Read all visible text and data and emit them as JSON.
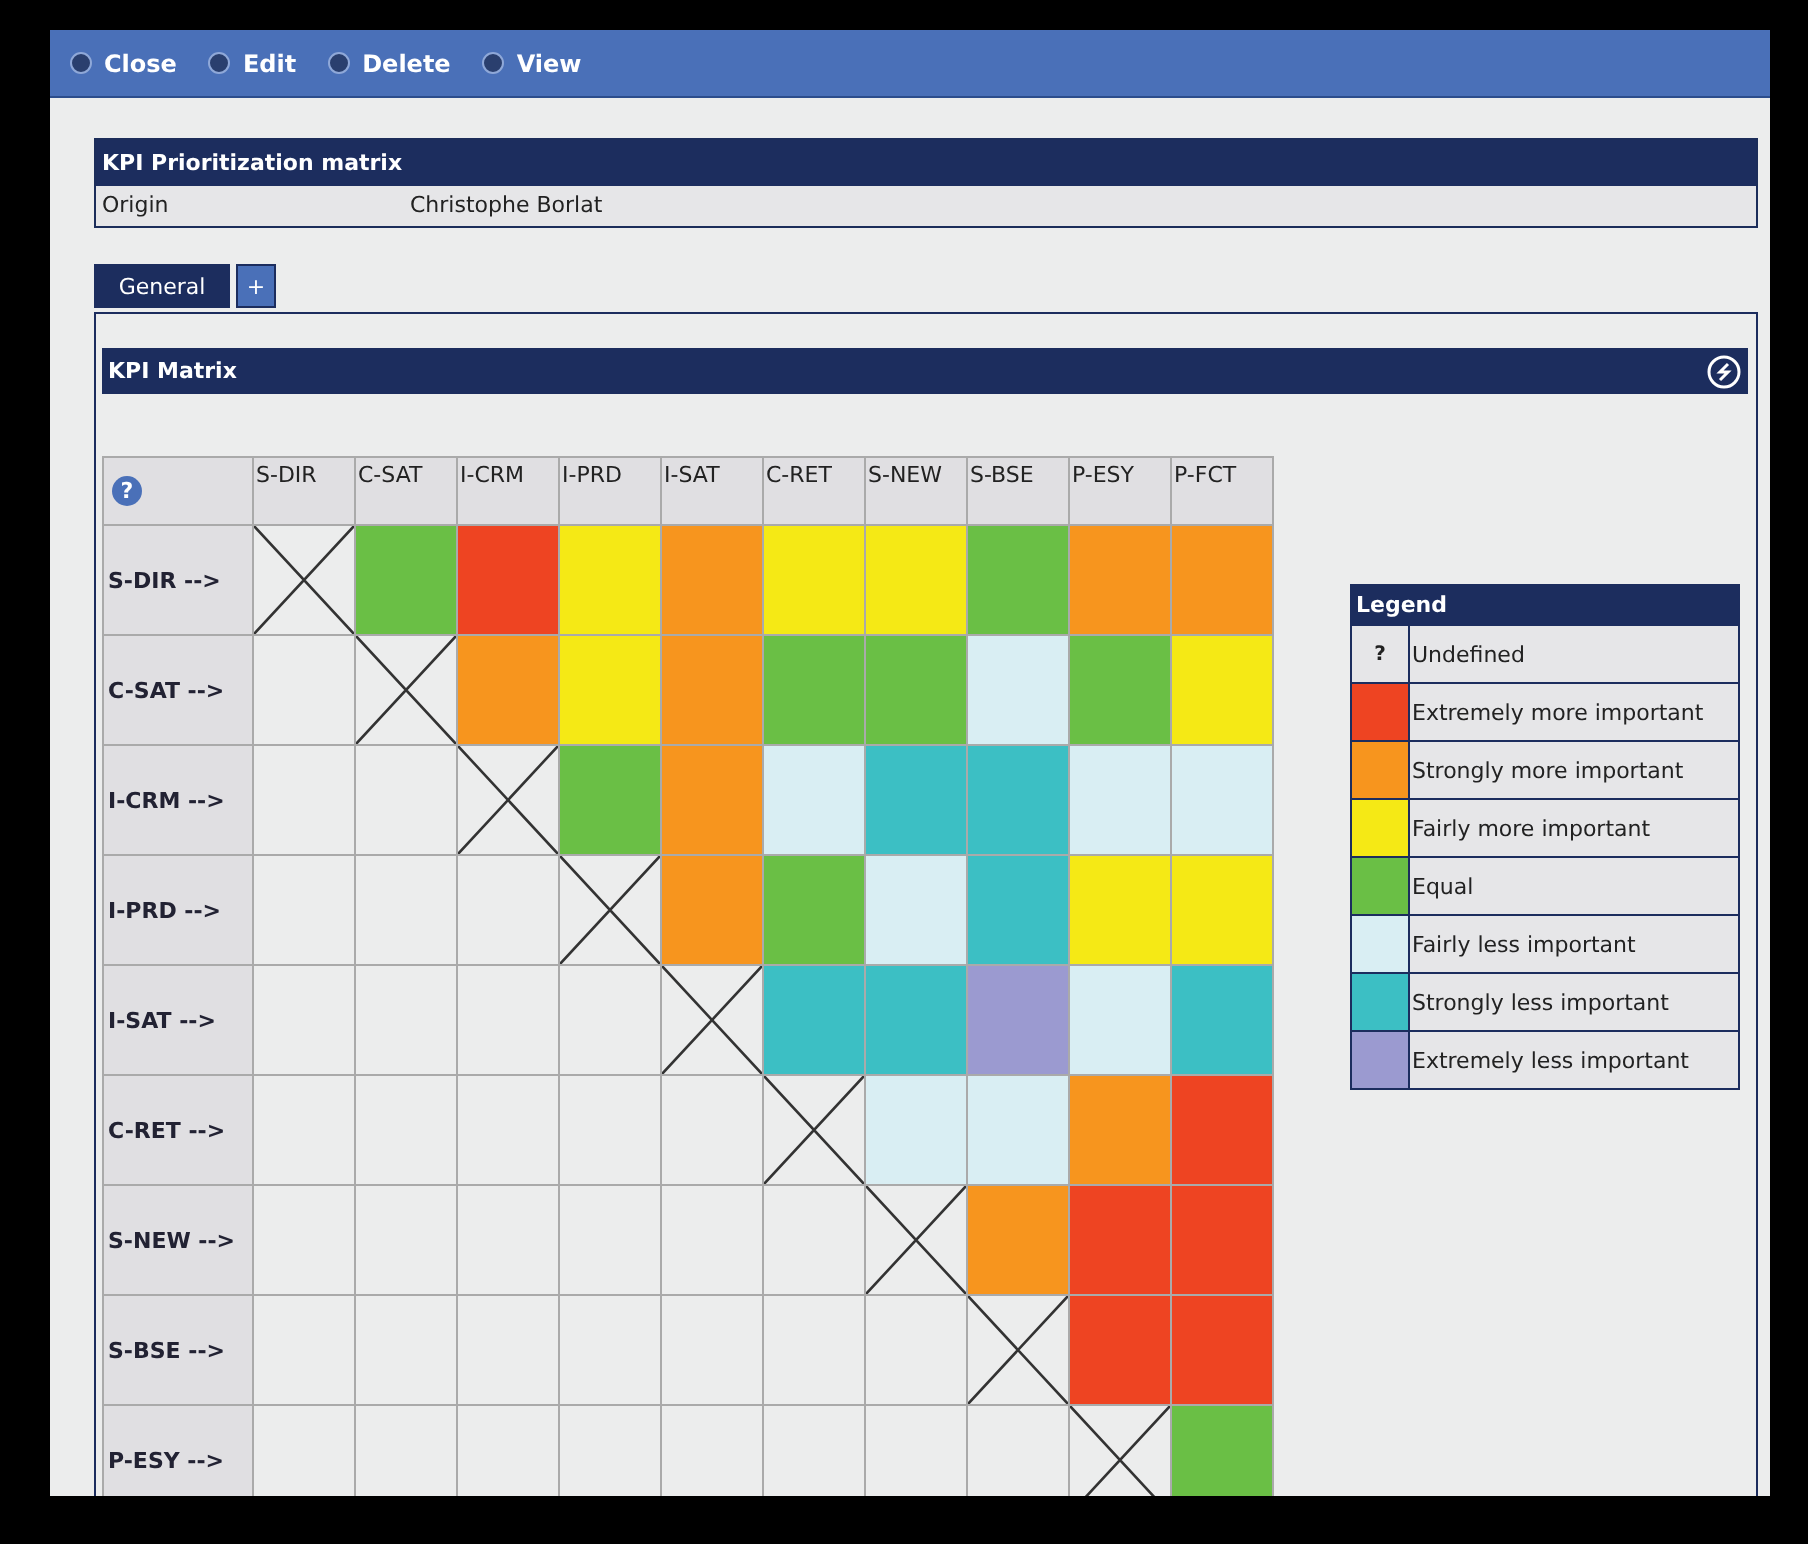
{
  "toolbar": [
    {
      "label": "Close"
    },
    {
      "label": "Edit"
    },
    {
      "label": "Delete"
    },
    {
      "label": "View"
    }
  ],
  "record": {
    "title": "KPI Prioritization matrix",
    "field_label": "Origin",
    "field_value": "Christophe Borlat"
  },
  "tabs": [
    {
      "label": "General",
      "selected": true
    },
    {
      "label": "+",
      "selected": false
    }
  ],
  "matrix": {
    "title": "KPI Matrix",
    "help_icon": "?",
    "columns": [
      "S-DIR",
      "C-SAT",
      "I-CRM",
      "I-PRD",
      "I-SAT",
      "C-RET",
      "S-NEW",
      "S-BSE",
      "P-ESY",
      "P-FCT"
    ],
    "rows": [
      {
        "label": "S-DIR -->",
        "cells": [
          {
            "kind": "cross"
          },
          {
            "kind": "rating",
            "color": "#6abf45"
          },
          {
            "kind": "rating",
            "color": "#ee4422"
          },
          {
            "kind": "rating",
            "color": "#f5e915"
          },
          {
            "kind": "rating",
            "color": "#f7951e"
          },
          {
            "kind": "rating",
            "color": "#f5e915"
          },
          {
            "kind": "rating",
            "color": "#f5e915"
          },
          {
            "kind": "rating",
            "color": "#6abf45"
          },
          {
            "kind": "rating",
            "color": "#f7951e"
          },
          {
            "kind": "rating",
            "color": "#f7951e"
          }
        ]
      },
      {
        "label": "C-SAT -->",
        "cells": [
          {
            "kind": "blank"
          },
          {
            "kind": "cross"
          },
          {
            "kind": "rating",
            "color": "#f7951e"
          },
          {
            "kind": "rating",
            "color": "#f5e915"
          },
          {
            "kind": "rating",
            "color": "#f7951e"
          },
          {
            "kind": "rating",
            "color": "#6abf45"
          },
          {
            "kind": "rating",
            "color": "#6abf45"
          },
          {
            "kind": "rating",
            "color": "#d9eef3"
          },
          {
            "kind": "rating",
            "color": "#6abf45"
          },
          {
            "kind": "rating",
            "color": "#f5e915"
          }
        ]
      },
      {
        "label": "I-CRM -->",
        "cells": [
          {
            "kind": "blank"
          },
          {
            "kind": "blank"
          },
          {
            "kind": "cross"
          },
          {
            "kind": "rating",
            "color": "#6abf45"
          },
          {
            "kind": "rating",
            "color": "#f7951e"
          },
          {
            "kind": "rating",
            "color": "#d9eef3"
          },
          {
            "kind": "rating",
            "color": "#3cbfc4"
          },
          {
            "kind": "rating",
            "color": "#3cbfc4"
          },
          {
            "kind": "rating",
            "color": "#d9eef3"
          },
          {
            "kind": "rating",
            "color": "#d9eef3"
          }
        ]
      },
      {
        "label": "I-PRD -->",
        "cells": [
          {
            "kind": "blank"
          },
          {
            "kind": "blank"
          },
          {
            "kind": "blank"
          },
          {
            "kind": "cross"
          },
          {
            "kind": "rating",
            "color": "#f7951e"
          },
          {
            "kind": "rating",
            "color": "#6abf45"
          },
          {
            "kind": "rating",
            "color": "#d9eef3"
          },
          {
            "kind": "rating",
            "color": "#3cbfc4"
          },
          {
            "kind": "rating",
            "color": "#f5e915"
          },
          {
            "kind": "rating",
            "color": "#f5e915"
          }
        ]
      },
      {
        "label": "I-SAT -->",
        "cells": [
          {
            "kind": "blank"
          },
          {
            "kind": "blank"
          },
          {
            "kind": "blank"
          },
          {
            "kind": "blank"
          },
          {
            "kind": "cross"
          },
          {
            "kind": "rating",
            "color": "#3cbfc4"
          },
          {
            "kind": "rating",
            "color": "#3cbfc4"
          },
          {
            "kind": "rating",
            "color": "#9b9ad0"
          },
          {
            "kind": "rating",
            "color": "#d9eef3"
          },
          {
            "kind": "rating",
            "color": "#3cbfc4"
          }
        ]
      },
      {
        "label": "C-RET -->",
        "cells": [
          {
            "kind": "blank"
          },
          {
            "kind": "blank"
          },
          {
            "kind": "blank"
          },
          {
            "kind": "blank"
          },
          {
            "kind": "blank"
          },
          {
            "kind": "cross"
          },
          {
            "kind": "rating",
            "color": "#d9eef3"
          },
          {
            "kind": "rating",
            "color": "#d9eef3"
          },
          {
            "kind": "rating",
            "color": "#f7951e"
          },
          {
            "kind": "rating",
            "color": "#ee4422"
          }
        ]
      },
      {
        "label": "S-NEW -->",
        "cells": [
          {
            "kind": "blank"
          },
          {
            "kind": "blank"
          },
          {
            "kind": "blank"
          },
          {
            "kind": "blank"
          },
          {
            "kind": "blank"
          },
          {
            "kind": "blank"
          },
          {
            "kind": "cross"
          },
          {
            "kind": "rating",
            "color": "#f7951e"
          },
          {
            "kind": "rating",
            "color": "#ee4422"
          },
          {
            "kind": "rating",
            "color": "#ee4422"
          }
        ]
      },
      {
        "label": "S-BSE -->",
        "cells": [
          {
            "kind": "blank"
          },
          {
            "kind": "blank"
          },
          {
            "kind": "blank"
          },
          {
            "kind": "blank"
          },
          {
            "kind": "blank"
          },
          {
            "kind": "blank"
          },
          {
            "kind": "blank"
          },
          {
            "kind": "cross"
          },
          {
            "kind": "rating",
            "color": "#ee4422"
          },
          {
            "kind": "rating",
            "color": "#ee4422"
          }
        ]
      },
      {
        "label": "P-ESY -->",
        "cells": [
          {
            "kind": "blank"
          },
          {
            "kind": "blank"
          },
          {
            "kind": "blank"
          },
          {
            "kind": "blank"
          },
          {
            "kind": "blank"
          },
          {
            "kind": "blank"
          },
          {
            "kind": "blank"
          },
          {
            "kind": "blank"
          },
          {
            "kind": "cross"
          },
          {
            "kind": "rating",
            "color": "#6abf45"
          }
        ]
      }
    ]
  },
  "legend": {
    "title": "Legend",
    "items": [
      {
        "kind": "mark",
        "mark": "?",
        "label": "Undefined"
      },
      {
        "kind": "swatch",
        "color": "#ee4422",
        "label": "Extremely more important"
      },
      {
        "kind": "swatch",
        "color": "#f7951e",
        "label": "Strongly more important"
      },
      {
        "kind": "swatch",
        "color": "#f5e915",
        "label": "Fairly more important"
      },
      {
        "kind": "swatch",
        "color": "#6abf45",
        "label": "Equal"
      },
      {
        "kind": "swatch",
        "color": "#d9eef3",
        "label": "Fairly less important"
      },
      {
        "kind": "swatch",
        "color": "#3cbfc4",
        "label": "Strongly less important"
      },
      {
        "kind": "swatch",
        "color": "#9b9ad0",
        "label": "Extremely less important"
      }
    ]
  }
}
